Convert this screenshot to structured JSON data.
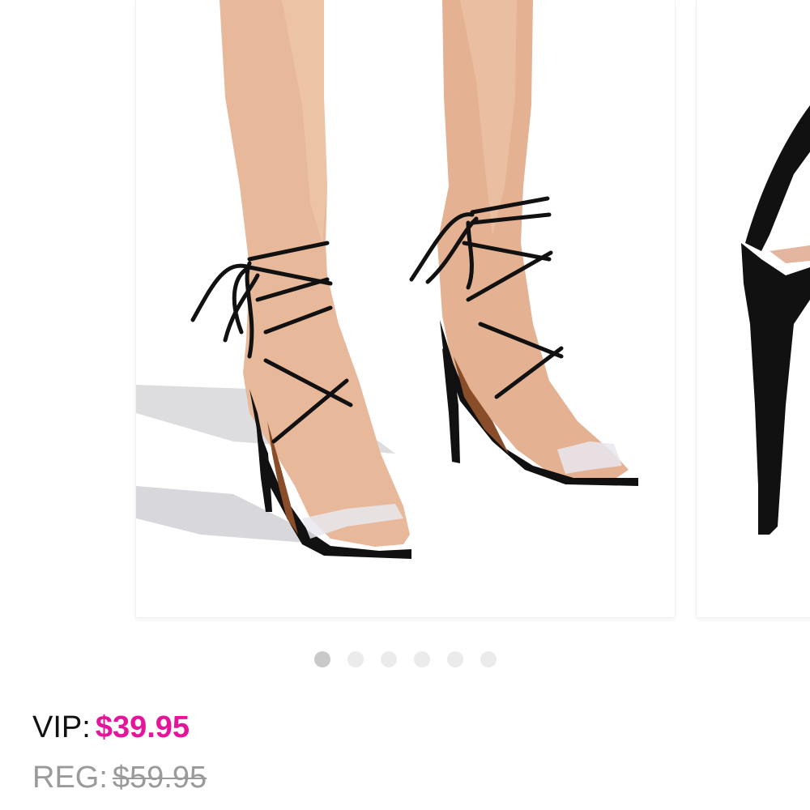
{
  "product": {
    "images": [
      {
        "name": "product-image-main",
        "alt": "Black lace-up heeled sandal with clear toe strap"
      },
      {
        "name": "product-image-next",
        "alt": ""
      }
    ],
    "carousel": {
      "dot_count": 6,
      "active_index": 0
    },
    "price": {
      "vip_label": "VIP:",
      "vip_amount": "$39.95",
      "reg_label": "REG:",
      "reg_amount": "$59.95"
    }
  },
  "colors": {
    "vip_price": "#e6149a",
    "reg_price": "#9a9a9a",
    "dot_active": "#c9c9c9",
    "dot_inactive": "#ebebeb"
  }
}
